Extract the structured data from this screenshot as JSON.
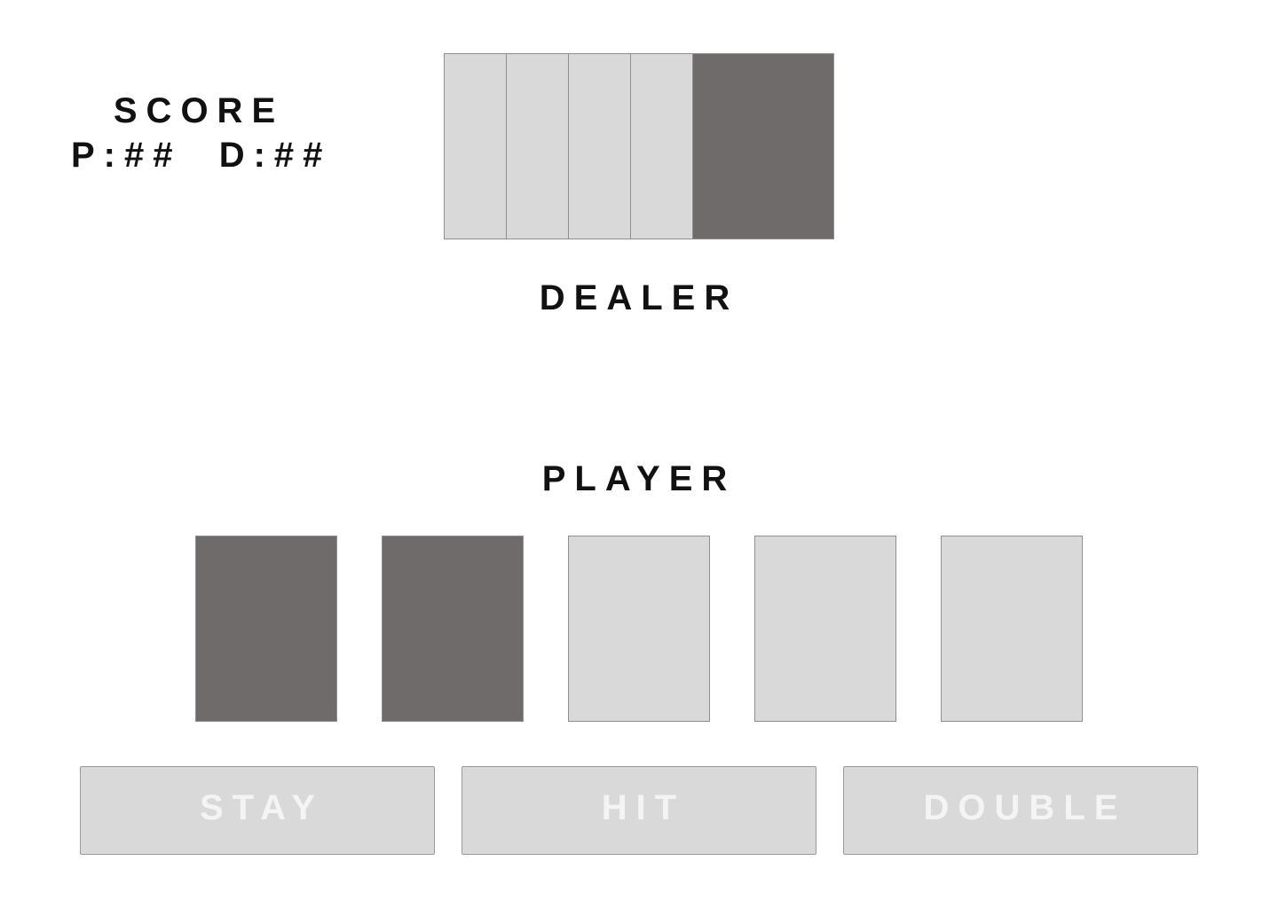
{
  "score": {
    "title": "SCORE",
    "values": "P:##  D:##"
  },
  "dealer": {
    "label": "DEALER",
    "cards": [
      {
        "state": "face-up"
      },
      {
        "state": "face-up"
      },
      {
        "state": "face-up"
      },
      {
        "state": "face-up"
      },
      {
        "state": "face-down"
      }
    ]
  },
  "player": {
    "label": "PLAYER",
    "cards": [
      {
        "state": "face-down"
      },
      {
        "state": "face-down"
      },
      {
        "state": "face-up"
      },
      {
        "state": "face-up"
      },
      {
        "state": "face-up"
      }
    ]
  },
  "actions": {
    "stay_label": "STAY",
    "hit_label": "HIT",
    "double_label": "DOUBLE"
  },
  "colors": {
    "card_light": "#d9d9d9",
    "card_dark": "#6f6b6a",
    "button_text": "#f4f4f4",
    "label_text": "#111111"
  }
}
